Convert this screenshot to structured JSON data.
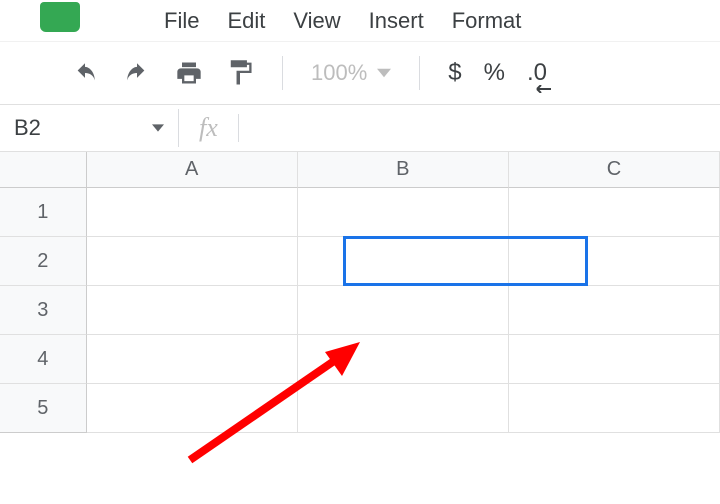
{
  "menu": {
    "file": "File",
    "edit": "Edit",
    "view": "View",
    "insert": "Insert",
    "format": "Format"
  },
  "toolbar": {
    "zoom_level": "100%",
    "currency": "$",
    "percent": "%",
    "decimal": ".0"
  },
  "namebox": {
    "value": "B2",
    "fx_label": "fx"
  },
  "formula_bar": {
    "value": ""
  },
  "columns": {
    "a": "A",
    "b": "B",
    "c": "C"
  },
  "rows": {
    "r1": "1",
    "r2": "2",
    "r3": "3",
    "r4": "4",
    "r5": "5"
  },
  "selection": {
    "cell": "B2"
  }
}
